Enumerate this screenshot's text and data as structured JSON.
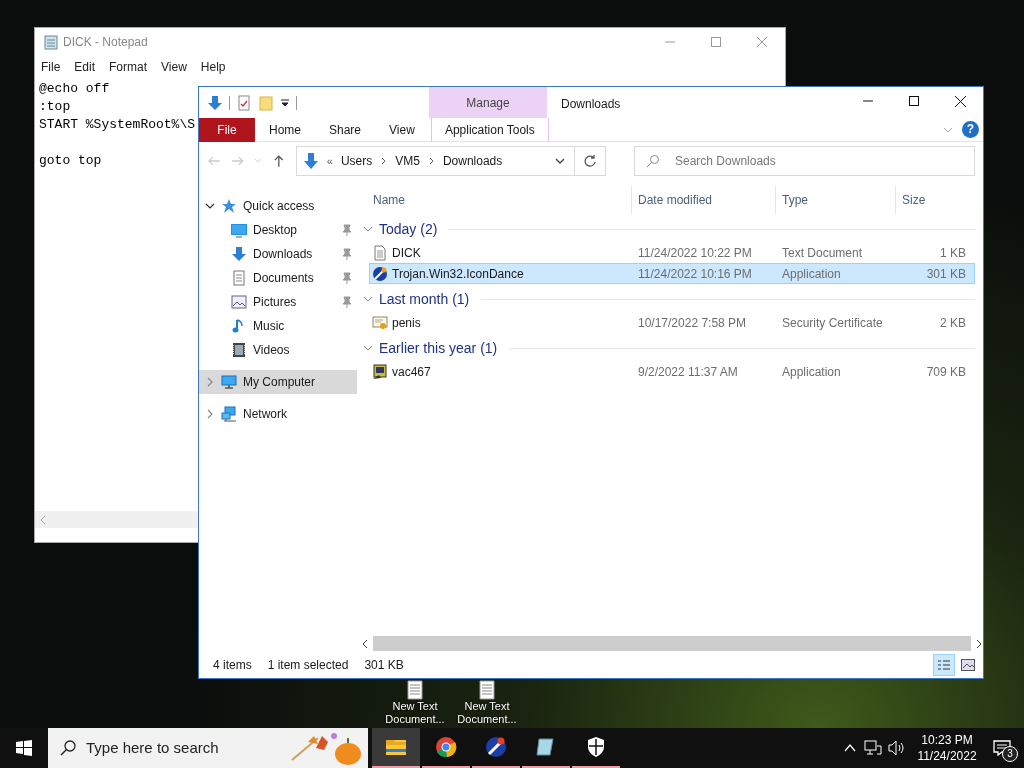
{
  "notepad": {
    "title": "DICK - Notepad",
    "menu": [
      "File",
      "Edit",
      "Format",
      "View",
      "Help"
    ],
    "blocks": [
      [
        "@echo off",
        ":top",
        "START %SystemRoot%\\S"
      ],
      [
        "goto top"
      ]
    ]
  },
  "explorer": {
    "title": "Downloads",
    "context_group": "Manage",
    "help": "?",
    "tabs": [
      {
        "label": "File",
        "kind": "file",
        "selected": false
      },
      {
        "label": "Home",
        "kind": "tab",
        "selected": false
      },
      {
        "label": "Share",
        "kind": "tab",
        "selected": false
      },
      {
        "label": "View",
        "kind": "tab",
        "selected": false
      },
      {
        "label": "Application Tools",
        "kind": "context",
        "selected": false
      }
    ],
    "address": {
      "overflow": "«",
      "segments": [
        "Users",
        "VM5",
        "Downloads"
      ]
    },
    "search": {
      "placeholder": "Search Downloads"
    },
    "nav": [
      {
        "label": "Quick access",
        "expanded": true,
        "selected": false,
        "children": [
          {
            "label": "Desktop",
            "pinned": true,
            "selected": false
          },
          {
            "label": "Downloads",
            "pinned": true,
            "selected": false
          },
          {
            "label": "Documents",
            "pinned": true,
            "selected": false
          },
          {
            "label": "Pictures",
            "pinned": true,
            "selected": false
          },
          {
            "label": "Music",
            "pinned": false,
            "selected": false
          },
          {
            "label": "Videos",
            "pinned": false,
            "selected": false
          }
        ]
      },
      {
        "label": "My Computer",
        "expanded": false,
        "selected": true
      },
      {
        "label": "Network",
        "expanded": false,
        "selected": false
      }
    ],
    "columns": [
      "Name",
      "Date modified",
      "Type",
      "Size"
    ],
    "groups": [
      {
        "label": "Today (2)",
        "files": [
          {
            "name": "DICK",
            "kind": "text",
            "date": "11/24/2022 10:22 PM",
            "type": "Text Document",
            "size": "1 KB",
            "selected": false
          },
          {
            "name": "Trojan.Win32.IconDance",
            "kind": "wand",
            "date": "11/24/2022 10:16 PM",
            "type": "Application",
            "size": "301 KB",
            "selected": true
          }
        ]
      },
      {
        "label": "Last month (1)",
        "files": [
          {
            "name": "penis",
            "kind": "certificate",
            "date": "10/17/2022 7:58 PM",
            "type": "Security Certificate",
            "size": "2 KB",
            "selected": false
          }
        ]
      },
      {
        "label": "Earlier this year (1)",
        "files": [
          {
            "name": "vac467",
            "kind": "setup",
            "date": "9/2/2022 11:37 AM",
            "type": "Application",
            "size": "709 KB",
            "selected": false
          }
        ]
      }
    ],
    "status": [
      "4 items",
      "1 item selected",
      "301 KB"
    ]
  },
  "desktop_icons": [
    "New Text Document...",
    "New Text Document..."
  ],
  "taskbar": {
    "search_placeholder": "Type here to search",
    "apps": [
      {
        "kind": "folder",
        "active": true
      },
      {
        "kind": "browser",
        "active": false
      },
      {
        "kind": "wand",
        "active": false
      },
      {
        "kind": "glass",
        "active": false
      },
      {
        "kind": "shield",
        "active": false
      }
    ],
    "time": "10:23 PM",
    "date": "11/24/2022",
    "notifications": "3"
  }
}
